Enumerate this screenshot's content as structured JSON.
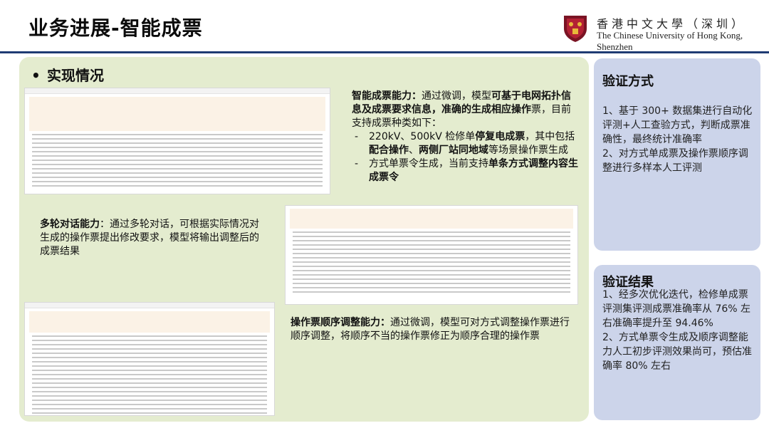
{
  "header": {
    "title": "业务进展-智能成票",
    "university_cn": "香港中文大學（深圳）",
    "university_en": "The Chinese University of Hong Kong, Shenzhen"
  },
  "main": {
    "section_title": "实现情况",
    "bullet": "•",
    "ability": {
      "lead": "智能成票能力：",
      "t1": "通过微调，模型",
      "b1": "可基于电网拓扑信息及成票要求信息，准确的生成相应操作",
      "t2": "票，目前支持成票种类如下：",
      "items": [
        {
          "t1": "220kV、500kV 检修单",
          "b1": "停复电成票",
          "t2": "，其中包括",
          "b2": "配合操作",
          "t3": "、",
          "b3": "两侧厂站同地域",
          "t4": "等场景操作票生成"
        },
        {
          "t1": "方式单票令生成，当前支持",
          "b1": "单条方式调整内容生成票令"
        }
      ]
    },
    "multi_turn": {
      "lead": "多轮对话能力",
      "text": "：通过多轮对话，可根据实际情况对生成的操作票提出修改要求，模型将输出调整后的成票结果"
    },
    "reorder": {
      "lead": "操作票顺序调整能力：",
      "text": "通过微调，模型可对方式调整操作票进行顺序调整，将顺序不当的操作票修正为顺序合理的操作票"
    }
  },
  "verify_method": {
    "title": "验证方式",
    "lines": [
      "1、基于 300+ 数据集进行自动化评测+人工查验方式，判断成票准确性，最终统计准确率",
      "2、对方式单成票及操作票顺序调整进行多样本人工评测"
    ]
  },
  "verify_result": {
    "title": "验证结果",
    "lines": [
      "1、经多次优化迭代，检修单成票评测集评测成票准确率从 76% 左右准确率提升至 94.46%",
      "2、方式单票令生成及顺序调整能力人工初步评测效果尚可，预估准确率 80% 左右"
    ]
  },
  "colors": {
    "main_panel": "#e4eccf",
    "side_panel": "#ccd4ea",
    "title_rule": "#1f3b73"
  }
}
